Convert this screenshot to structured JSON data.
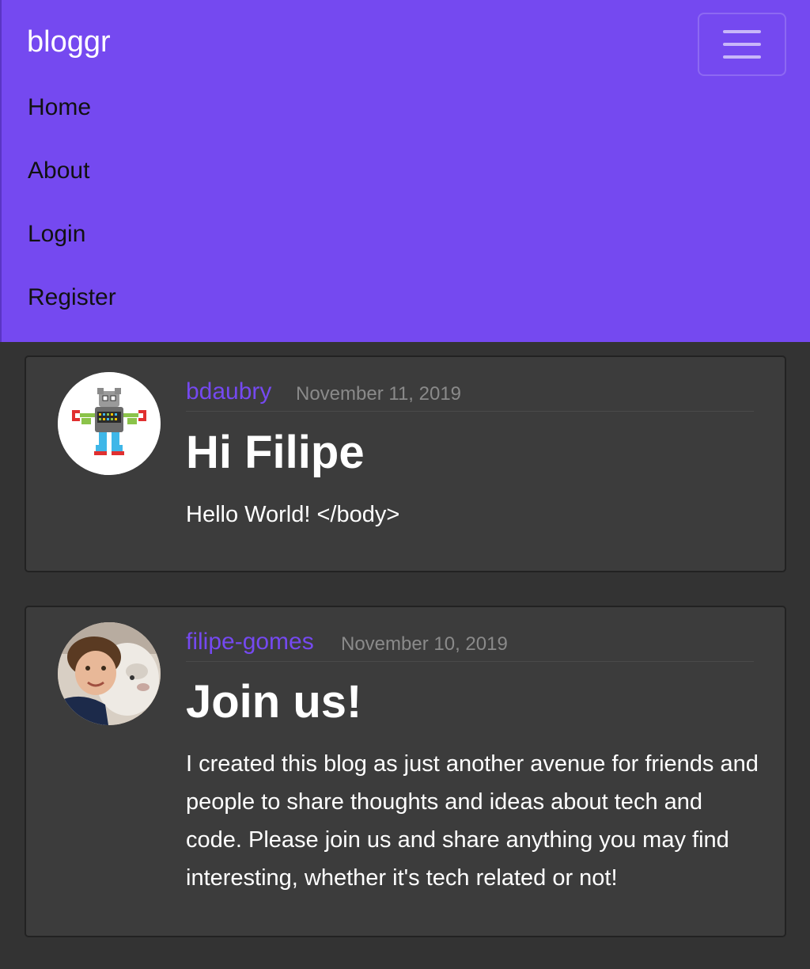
{
  "navbar": {
    "brand": "bloggr",
    "toggler_icon": "hamburger-menu-icon",
    "links": [
      "Home",
      "About",
      "Login",
      "Register"
    ],
    "background_color": "#7549F0"
  },
  "posts": [
    {
      "author": "bdaubry",
      "date": "November 11, 2019",
      "title": "Hi Filipe",
      "content": "Hello World! </body>",
      "avatar": "robot-avatar"
    },
    {
      "author": "filipe-gomes",
      "date": "November 10, 2019",
      "title": "Join us!",
      "content": "I created this blog as just another avenue for friends and people to share thoughts and ideas about tech and code. Please join us and share anything you may find interesting, whether it's tech related or not!",
      "avatar": "child-with-dog-avatar"
    }
  ],
  "colors": {
    "accent": "#7549F0",
    "page_background": "#333333",
    "card_background": "#3c3c3c",
    "muted_text": "#8a8a8a"
  }
}
